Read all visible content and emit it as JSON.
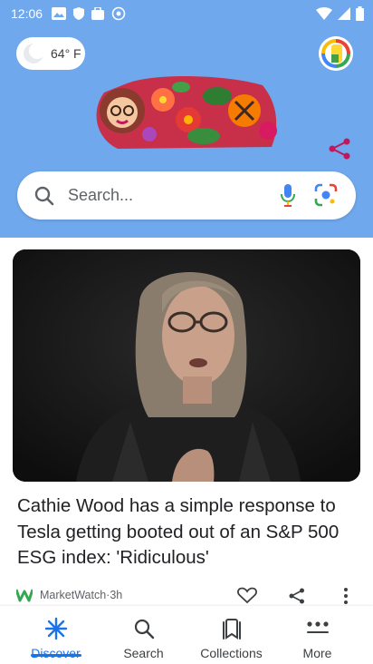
{
  "status_bar": {
    "time": "12:06"
  },
  "header": {
    "weather_temp": "64° F",
    "colors": {
      "background": "#6fa8ec",
      "accent": "#1a73e8"
    }
  },
  "search": {
    "placeholder": "Search..."
  },
  "feed": {
    "card": {
      "headline": "Cathie Wood has a simple response to Tesla getting booted out of an S&P 500 ESG index: 'Ridiculous'",
      "source": "MarketWatch",
      "age": "3h",
      "separator": " · "
    }
  },
  "bottom_nav": {
    "items": [
      {
        "label": "Discover",
        "icon": "asterisk-icon",
        "active": true
      },
      {
        "label": "Search",
        "icon": "search-icon",
        "active": false
      },
      {
        "label": "Collections",
        "icon": "collections-icon",
        "active": false
      },
      {
        "label": "More",
        "icon": "more-dots-icon",
        "active": false
      }
    ]
  }
}
